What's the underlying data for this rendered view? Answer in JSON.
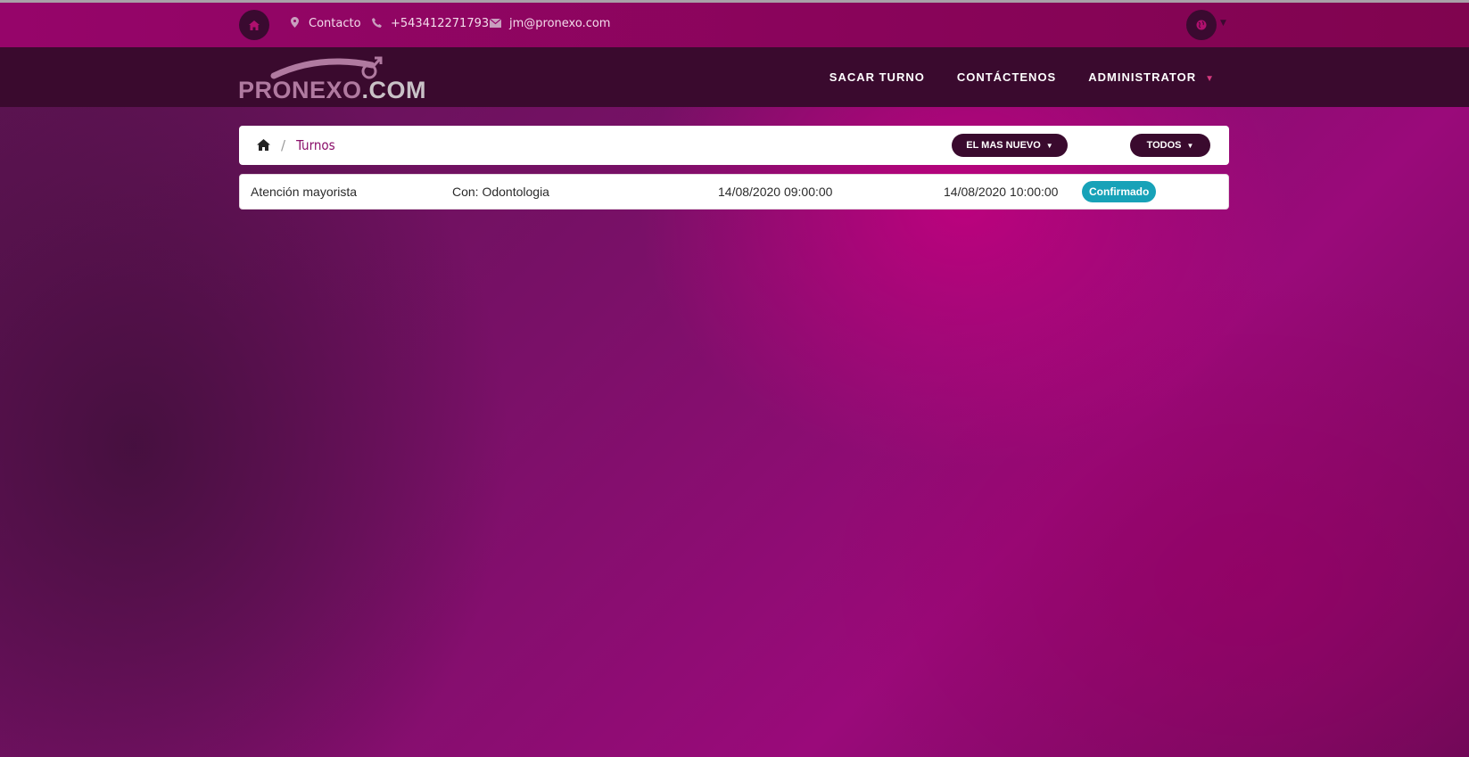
{
  "topbar": {
    "contact_label": "Contacto",
    "phone": "+543412271793",
    "email": "jm@pronexo.com"
  },
  "logo": {
    "main": "PRONEXO",
    "suffix": ".COM"
  },
  "nav": {
    "items": [
      "SACAR TURNO",
      "CONTÁCTENOS",
      "ADMINISTRATOR"
    ]
  },
  "breadcrumb": {
    "separator": "/",
    "current": "Turnos"
  },
  "filters": {
    "sort_label": "EL MAS NUEVO",
    "filter_label": "TODOS"
  },
  "appointments": [
    {
      "title": "Atención mayorista",
      "with": "Con: Odontologia",
      "start": "14/08/2020 09:00:00",
      "end": "14/08/2020 10:00:00",
      "status": "Confirmado"
    }
  ],
  "colors": {
    "topbar": "#96056a",
    "navbar": "#3a0a2e",
    "accent": "#8a0f6a",
    "status_confirmed": "#17a2b8"
  },
  "icons": [
    "home-icon",
    "map-marker-icon",
    "phone-icon",
    "envelope-icon",
    "globe-icon",
    "caret-down-icon"
  ]
}
